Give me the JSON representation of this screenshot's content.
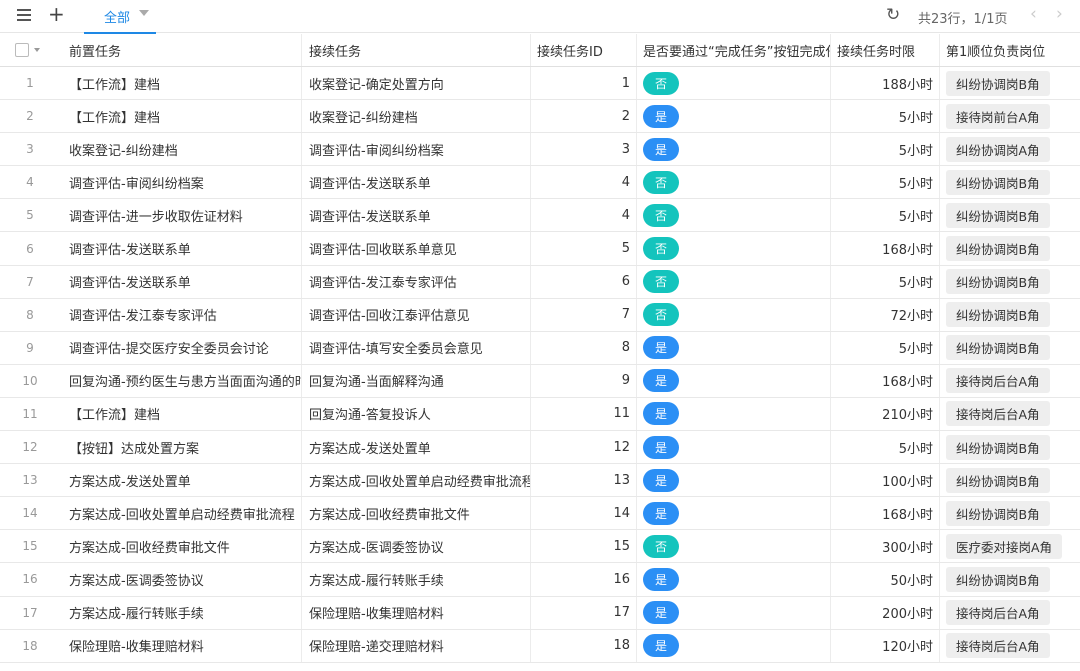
{
  "toolbar": {
    "tab_label": "全部",
    "page_info": "共23行，1/1页",
    "refresh_icon": "↻",
    "prev_icon": "‹",
    "next_icon": "›",
    "add_icon": "+"
  },
  "columns": {
    "pre": "前置任务",
    "next": "接续任务",
    "id": "接续任务ID",
    "flag": "是否要通过“完成任务”按钮完成任务",
    "limit": "接续任务时限",
    "role": "第1顺位负责岗位"
  },
  "colors": {
    "pill_yes": "#2b8ff5",
    "pill_no": "#14c4bd",
    "accent": "#1e88e5"
  },
  "rows": [
    {
      "num": "1",
      "pre": "【工作流】建档",
      "next": "收案登记-确定处置方向",
      "id": "1",
      "flag": "否",
      "limit": "188小时",
      "role": "纠纷协调岗B角"
    },
    {
      "num": "2",
      "pre": "【工作流】建档",
      "next": "收案登记-纠纷建档",
      "id": "2",
      "flag": "是",
      "limit": "5小时",
      "role": "接待岗前台A角"
    },
    {
      "num": "3",
      "pre": "收案登记-纠纷建档",
      "next": "调查评估-审阅纠纷档案",
      "id": "3",
      "flag": "是",
      "limit": "5小时",
      "role": "纠纷协调岗A角"
    },
    {
      "num": "4",
      "pre": "调查评估-审阅纠纷档案",
      "next": "调查评估-发送联系单",
      "id": "4",
      "flag": "否",
      "limit": "5小时",
      "role": "纠纷协调岗B角"
    },
    {
      "num": "5",
      "pre": "调查评估-进一步收取佐证材料",
      "next": "调查评估-发送联系单",
      "id": "4",
      "flag": "否",
      "limit": "5小时",
      "role": "纠纷协调岗B角"
    },
    {
      "num": "6",
      "pre": "调查评估-发送联系单",
      "next": "调查评估-回收联系单意见",
      "id": "5",
      "flag": "否",
      "limit": "168小时",
      "role": "纠纷协调岗B角"
    },
    {
      "num": "7",
      "pre": "调查评估-发送联系单",
      "next": "调查评估-发江泰专家评估",
      "id": "6",
      "flag": "否",
      "limit": "5小时",
      "role": "纠纷协调岗B角"
    },
    {
      "num": "8",
      "pre": "调查评估-发江泰专家评估",
      "next": "调查评估-回收江泰评估意见",
      "id": "7",
      "flag": "否",
      "limit": "72小时",
      "role": "纠纷协调岗B角"
    },
    {
      "num": "9",
      "pre": "调查评估-提交医疗安全委员会讨论",
      "next": "调查评估-填写安全委员会意见",
      "id": "8",
      "flag": "是",
      "limit": "5小时",
      "role": "纠纷协调岗B角"
    },
    {
      "num": "10",
      "pre": "回复沟通-预约医生与患方当面面沟通的时",
      "next": "回复沟通-当面解释沟通",
      "id": "9",
      "flag": "是",
      "limit": "168小时",
      "role": "接待岗后台A角"
    },
    {
      "num": "11",
      "pre": "【工作流】建档",
      "next": "回复沟通-答复投诉人",
      "id": "11",
      "flag": "是",
      "limit": "210小时",
      "role": "接待岗后台A角"
    },
    {
      "num": "12",
      "pre": "【按钮】达成处置方案",
      "next": "方案达成-发送处置单",
      "id": "12",
      "flag": "是",
      "limit": "5小时",
      "role": "纠纷协调岗B角"
    },
    {
      "num": "13",
      "pre": "方案达成-发送处置单",
      "next": "方案达成-回收处置单启动经费审批流程",
      "id": "13",
      "flag": "是",
      "limit": "100小时",
      "role": "纠纷协调岗B角"
    },
    {
      "num": "14",
      "pre": "方案达成-回收处置单启动经费审批流程",
      "next": "方案达成-回收经费审批文件",
      "id": "14",
      "flag": "是",
      "limit": "168小时",
      "role": "纠纷协调岗B角"
    },
    {
      "num": "15",
      "pre": "方案达成-回收经费审批文件",
      "next": "方案达成-医调委签协议",
      "id": "15",
      "flag": "否",
      "limit": "300小时",
      "role": "医疗委对接岗A角"
    },
    {
      "num": "16",
      "pre": "方案达成-医调委签协议",
      "next": "方案达成-履行转账手续",
      "id": "16",
      "flag": "是",
      "limit": "50小时",
      "role": "纠纷协调岗B角"
    },
    {
      "num": "17",
      "pre": "方案达成-履行转账手续",
      "next": "保险理赔-收集理赔材料",
      "id": "17",
      "flag": "是",
      "limit": "200小时",
      "role": "接待岗后台A角"
    },
    {
      "num": "18",
      "pre": "保险理赔-收集理赔材料",
      "next": "保险理赔-递交理赔材料",
      "id": "18",
      "flag": "是",
      "limit": "120小时",
      "role": "接待岗后台A角"
    }
  ]
}
